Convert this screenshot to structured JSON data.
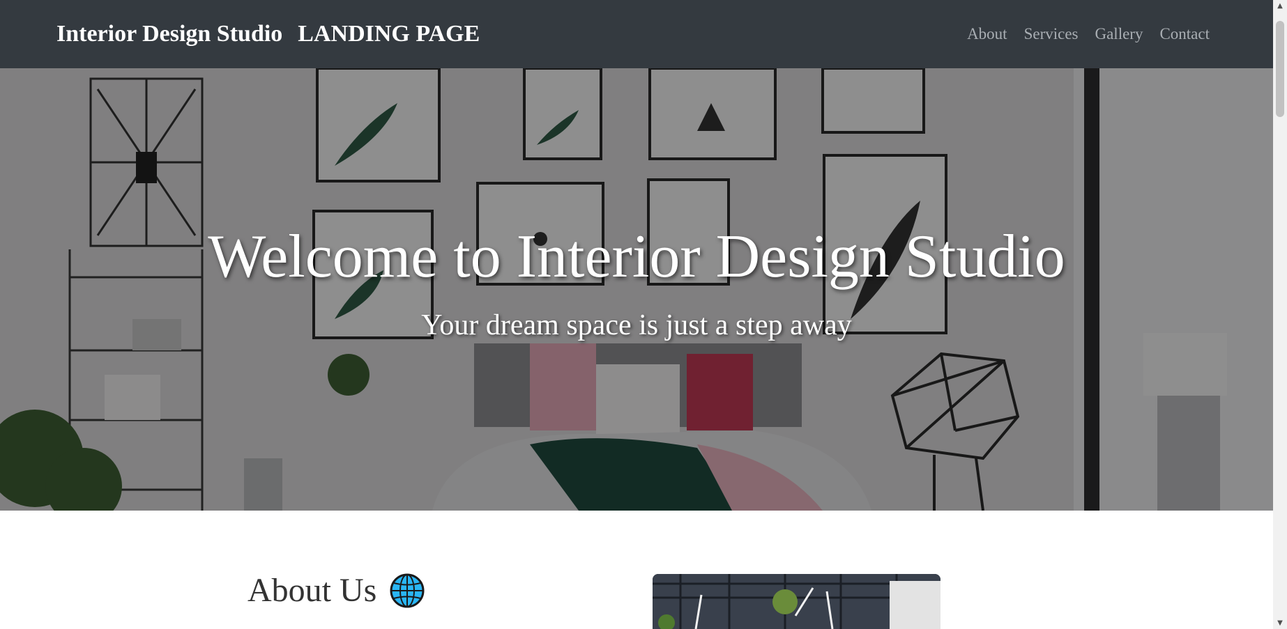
{
  "navbar": {
    "brand": "Interior Design Studio",
    "brand_sub": "LANDING PAGE",
    "links": [
      "About",
      "Services",
      "Gallery",
      "Contact"
    ]
  },
  "hero": {
    "title": "Welcome to Interior Design Studio",
    "subtitle": "Your dream space is just a step away"
  },
  "about": {
    "heading": "About Us",
    "icon": "globe-icon"
  },
  "colors": {
    "navbar_bg": "#343a40",
    "nav_link": "#a9aeb3",
    "hero_text": "#ffffff",
    "heading_text": "#333333"
  }
}
